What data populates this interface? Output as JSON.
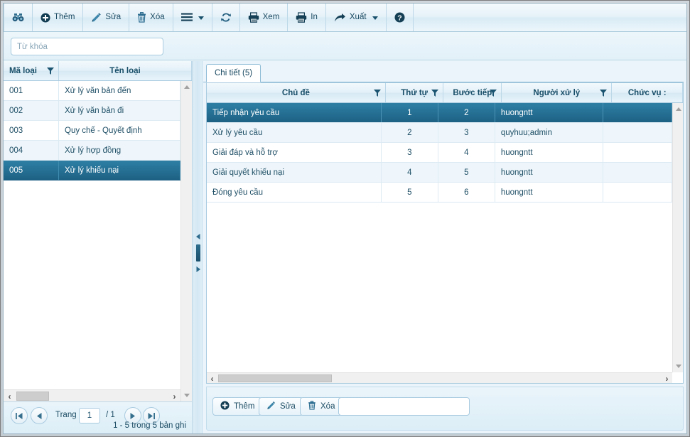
{
  "toolbar": {
    "buttons": [
      {
        "icon": "binoculars-icon",
        "label": ""
      },
      {
        "icon": "plus-circle-icon",
        "label": "Thêm"
      },
      {
        "icon": "pencil-icon",
        "label": "Sửa"
      },
      {
        "icon": "trash-icon",
        "label": "Xóa"
      },
      {
        "icon": "hamburger-menu-icon",
        "label": "",
        "caret": true
      },
      {
        "icon": "refresh-icon",
        "label": ""
      },
      {
        "icon": "print-preview-icon",
        "label": "Xem"
      },
      {
        "icon": "printer-icon",
        "label": "In"
      },
      {
        "icon": "export-arrow-icon",
        "label": "Xuất",
        "caret": true
      },
      {
        "icon": "help-question-icon",
        "label": ""
      }
    ]
  },
  "search": {
    "placeholder": "Từ khóa",
    "value": ""
  },
  "left_grid": {
    "columns": [
      {
        "label": "Mã loại",
        "filter": true
      },
      {
        "label": "Tên loại",
        "filter": false
      }
    ],
    "rows": [
      {
        "code": "001",
        "name": "Xử lý văn bản đến",
        "selected": false
      },
      {
        "code": "002",
        "name": "Xử lý văn bản đi",
        "selected": false
      },
      {
        "code": "003",
        "name": "Quy chế - Quyết định",
        "selected": false
      },
      {
        "code": "004",
        "name": "Xử lý hợp đồng",
        "selected": false
      },
      {
        "code": "005",
        "name": "Xử lý khiếu nại",
        "selected": true
      }
    ]
  },
  "pager": {
    "page_label": "Trang",
    "page_value": "1",
    "total_pages": "/ 1",
    "summary": "1 - 5 trong 5 bản ghi",
    "first_icon": "first-page-icon",
    "prev_icon": "prev-page-icon",
    "next_icon": "next-page-icon",
    "last_icon": "last-page-icon"
  },
  "detail": {
    "tab_label": "Chi tiết (5)",
    "columns": [
      {
        "label": "Chủ đề",
        "filter": true
      },
      {
        "label": "Thứ tự",
        "filter": true
      },
      {
        "label": "Bước tiếp",
        "filter": true
      },
      {
        "label": "Người xử lý",
        "filter": true
      },
      {
        "label": "Chức vụ :",
        "filter": false
      }
    ],
    "rows": [
      {
        "subject": "Tiếp nhận yêu cầu",
        "order": "1",
        "next_step": "2",
        "handler": "huongntt",
        "position": "",
        "selected": true
      },
      {
        "subject": "Xử lý yêu cầu",
        "order": "2",
        "next_step": "3",
        "handler": "quyhuu;admin",
        "position": "",
        "selected": false
      },
      {
        "subject": "Giải đáp và hỗ trợ",
        "order": "3",
        "next_step": "4",
        "handler": "huongntt",
        "position": "",
        "selected": false
      },
      {
        "subject": "Giải quyết khiếu nại",
        "order": "4",
        "next_step": "5",
        "handler": "huongntt",
        "position": "",
        "selected": false
      },
      {
        "subject": "Đóng yêu cầu",
        "order": "5",
        "next_step": "6",
        "handler": "huongntt",
        "position": "",
        "selected": false
      }
    ]
  },
  "bottom_bar": {
    "add_label": "Thêm",
    "edit_label": "Sửa",
    "delete_label": "Xóa",
    "input_value": "",
    "input_placeholder": ""
  },
  "colors": {
    "accent": "#1d6184",
    "selection": "#2e7fa5",
    "header_text": "#184e68",
    "panel_bg": "#eaf4fa",
    "border": "#a9cbe0"
  }
}
